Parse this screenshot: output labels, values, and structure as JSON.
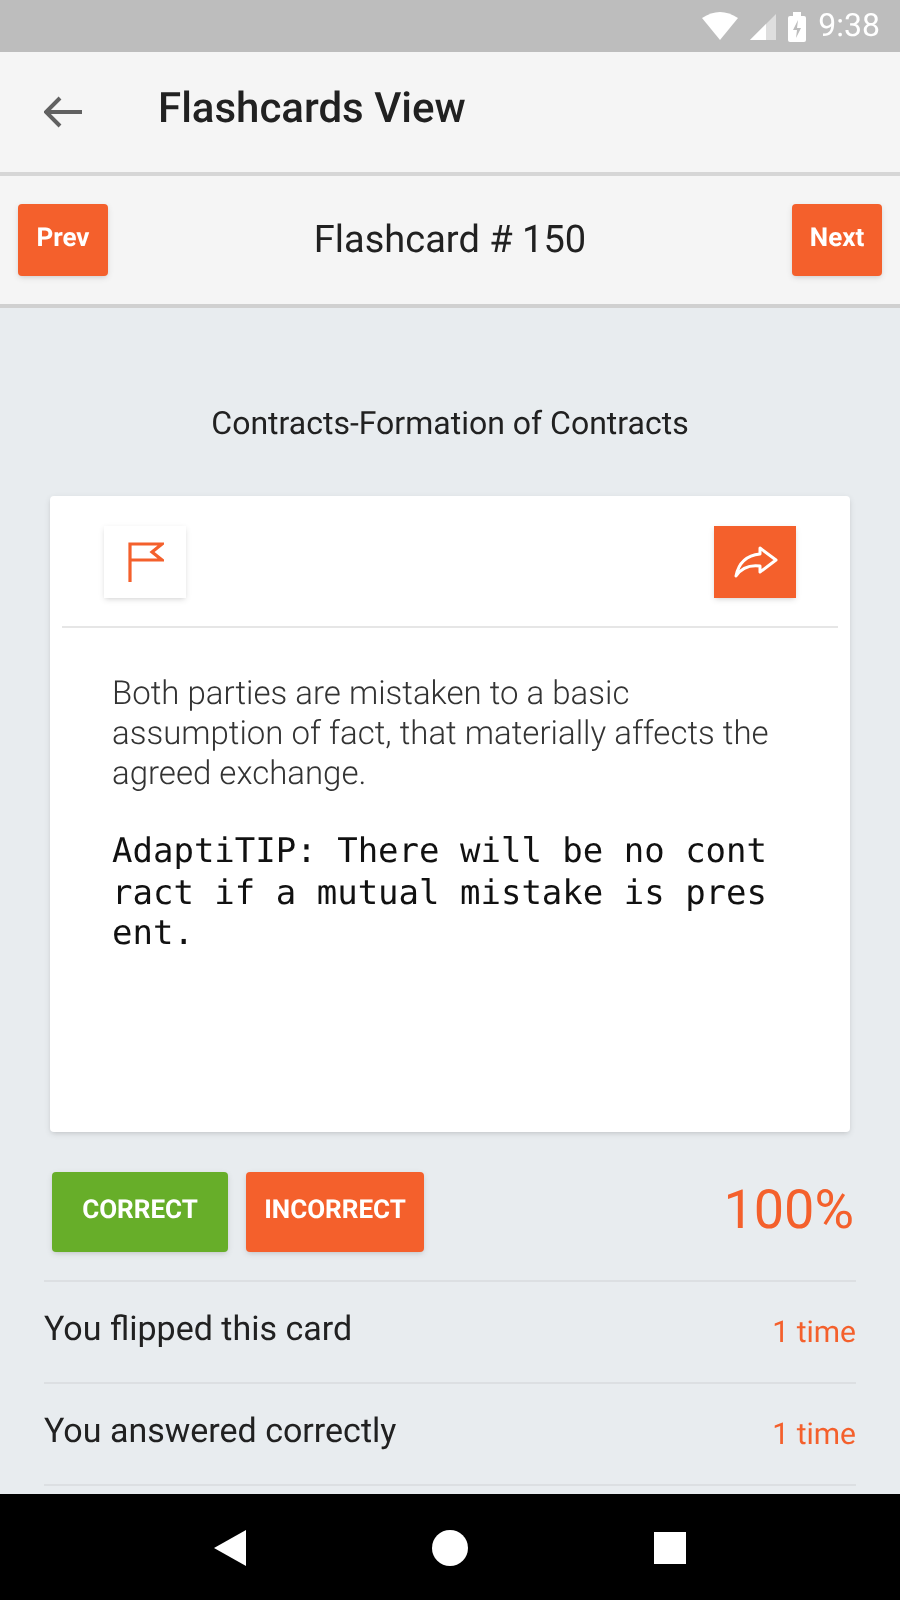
{
  "status_bar": {
    "time": "9:38"
  },
  "app_bar": {
    "title": "Flashcards View"
  },
  "pager": {
    "prev": "Prev",
    "title": "Flashcard # 150",
    "next": "Next"
  },
  "card": {
    "topic": "Contracts-Formation of Contracts",
    "answer": "Both parties are mistaken to a basic assumption of fact, that materially affects the agreed exchange.",
    "tip": "AdaptiTIP: There will be no contract if a mutual mistake is present."
  },
  "actions": {
    "correct": "CORRECT",
    "incorrect": "INCORRECT",
    "score": "100%"
  },
  "stats": [
    {
      "label": "You flipped this card",
      "value": "1 time"
    },
    {
      "label": "You answered correctly",
      "value": "1 time"
    }
  ]
}
